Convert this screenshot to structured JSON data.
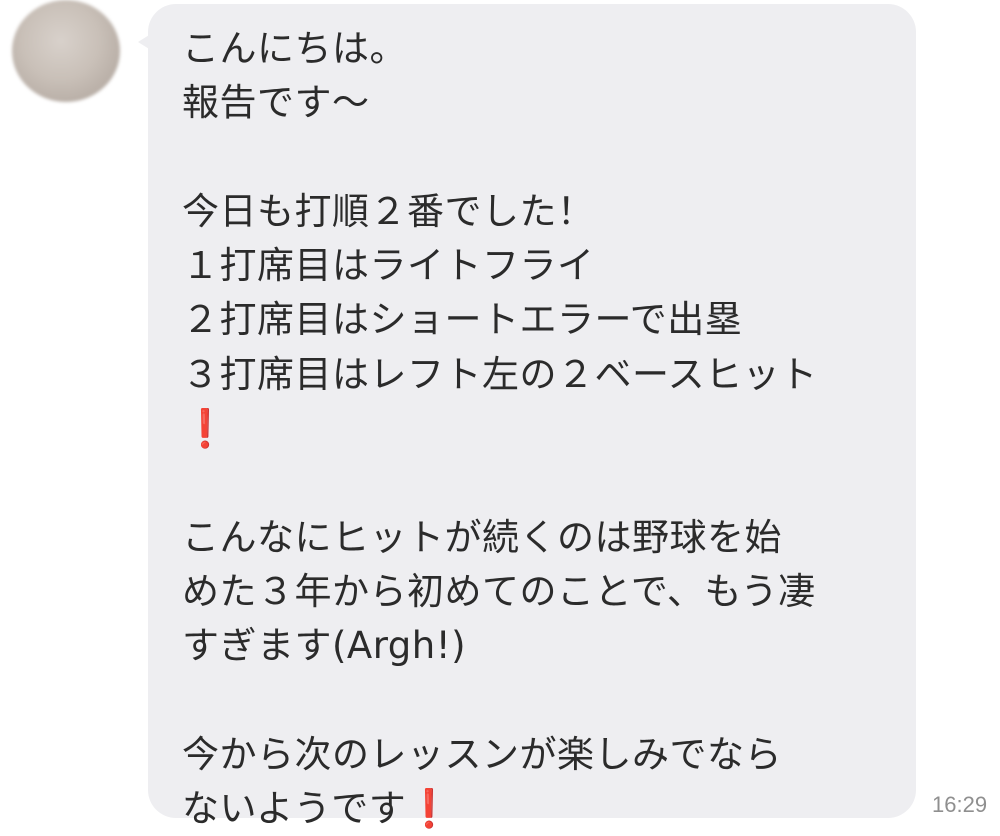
{
  "message": {
    "lines": [
      "こんにちは。",
      "報告です〜",
      "",
      "今日も打順２番でした！",
      "１打席目はライトフライ",
      "２打席目はショートエラーで出塁",
      "３打席目はレフト左の２ベースヒット",
      "",
      "",
      "こんなにヒットが続くのは野球を始",
      "めた３年から初めてのことで、もう凄",
      "すぎます(Argh!)",
      "",
      "今から次のレッスンが楽しみでなら",
      "ないようです"
    ],
    "emoji": "❗",
    "timestamp": "16:29"
  },
  "colors": {
    "bubble": "#eeeef1",
    "text": "#2b2b2b",
    "exclamation": "#d8161b",
    "timestamp": "#8f8f8f"
  }
}
